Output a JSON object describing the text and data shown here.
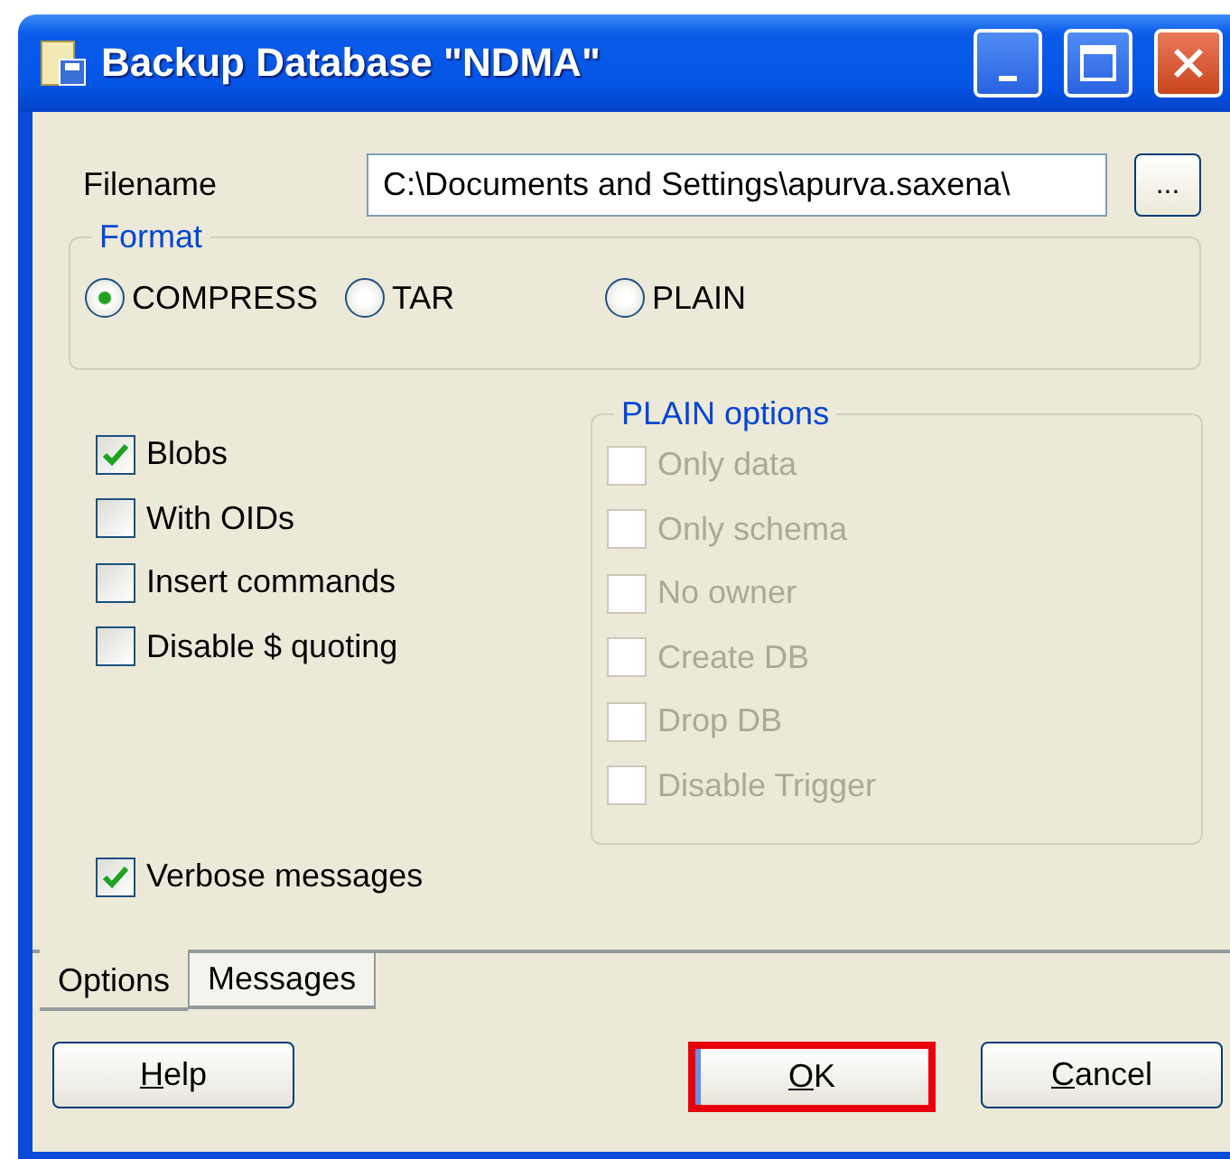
{
  "window": {
    "title": "Backup Database \"NDMA\"",
    "controls": [
      {
        "kind": "minimize"
      },
      {
        "kind": "maximize"
      },
      {
        "kind": "close"
      }
    ]
  },
  "filename": {
    "label": "Filename",
    "value": "C:\\Documents and Settings\\apurva.saxena\\",
    "browse": "..."
  },
  "format": {
    "legend": "Format",
    "options": [
      {
        "label": "COMPRESS",
        "selected": true
      },
      {
        "label": "TAR",
        "selected": false
      },
      {
        "label": "PLAIN",
        "selected": false
      }
    ]
  },
  "options": [
    {
      "label": "Blobs",
      "checked": true
    },
    {
      "label": "With OIDs",
      "checked": false
    },
    {
      "label": "Insert commands",
      "checked": false
    },
    {
      "label": "Disable $ quoting",
      "checked": false
    }
  ],
  "plain_options": {
    "legend": "PLAIN options",
    "disabled": true,
    "items": [
      {
        "label": "Only data",
        "checked": false
      },
      {
        "label": "Only schema",
        "checked": false
      },
      {
        "label": "No owner",
        "checked": false
      },
      {
        "label": "Create DB",
        "checked": false
      },
      {
        "label": "Drop DB",
        "checked": false
      },
      {
        "label": "Disable Trigger",
        "checked": false
      }
    ]
  },
  "verbose": {
    "label": "Verbose messages",
    "checked": true
  },
  "tabs": [
    {
      "label": "Options",
      "selected": true
    },
    {
      "label": "Messages",
      "selected": false
    }
  ],
  "buttons": [
    {
      "label": "Help",
      "highlighted": false
    },
    {
      "label": "OK",
      "highlighted": true
    },
    {
      "label": "Cancel",
      "highlighted": false
    }
  ]
}
